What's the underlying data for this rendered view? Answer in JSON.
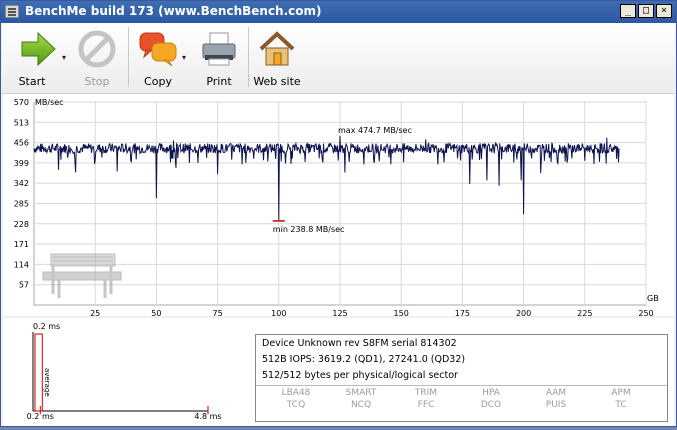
{
  "window": {
    "title": "BenchMe build 173 (www.BenchBench.com)",
    "controls": {
      "minimize": "_",
      "maximize": "□",
      "close": "×"
    }
  },
  "toolbar": {
    "start_label": "Start",
    "stop_label": "Stop",
    "copy_label": "Copy",
    "print_label": "Print",
    "website_label": "Web site",
    "icons": {
      "start": "green-arrow-right",
      "stop": "no-entry",
      "copy": "speech-bubbles",
      "print": "printer",
      "website": "house"
    },
    "dropdown_arrow": "▾"
  },
  "chart_data": [
    {
      "type": "line",
      "title": "",
      "ylabel": "MB/sec",
      "xlabel": "GB",
      "ylim": [
        0,
        570
      ],
      "xlim": [
        0,
        250
      ],
      "yticks": [
        "570",
        "513",
        "456",
        "399",
        "342",
        "285",
        "228",
        "171",
        "114",
        "57"
      ],
      "xticks": [
        "25",
        "50",
        "75",
        "100",
        "125",
        "150",
        "175",
        "200",
        "225",
        "250"
      ],
      "grid": true,
      "annotations": {
        "max": "max 474.7 MB/sec",
        "min": "min 238.8 MB/sec",
        "max_value": 474.7,
        "min_value": 238.8,
        "max_x": 125,
        "min_x": 100
      },
      "series": [
        {
          "baseline": 440,
          "x_end": 239,
          "dips": [
            {
              "x": 10,
              "y": 380
            },
            {
              "x": 17,
              "y": 372
            },
            {
              "x": 34,
              "y": 375
            },
            {
              "x": 50,
              "y": 300
            },
            {
              "x": 58,
              "y": 385
            },
            {
              "x": 67,
              "y": 399
            },
            {
              "x": 75,
              "y": 368
            },
            {
              "x": 85,
              "y": 395
            },
            {
              "x": 100,
              "y": 238.8
            },
            {
              "x": 118,
              "y": 400
            },
            {
              "x": 127,
              "y": 372
            },
            {
              "x": 139,
              "y": 399
            },
            {
              "x": 151,
              "y": 401
            },
            {
              "x": 165,
              "y": 395
            },
            {
              "x": 178,
              "y": 340
            },
            {
              "x": 185,
              "y": 350
            },
            {
              "x": 190,
              "y": 335
            },
            {
              "x": 196,
              "y": 400
            },
            {
              "x": 199,
              "y": 350
            },
            {
              "x": 200,
              "y": 255
            },
            {
              "x": 207,
              "y": 370
            },
            {
              "x": 214,
              "y": 398
            },
            {
              "x": 225,
              "y": 405
            },
            {
              "x": 231,
              "y": 402
            }
          ],
          "peaks": [
            {
              "x": 57,
              "y": 462
            },
            {
              "x": 125,
              "y": 474.7
            },
            {
              "x": 160,
              "y": 465
            },
            {
              "x": 234,
              "y": 470
            }
          ]
        }
      ]
    },
    {
      "type": "bar",
      "title": "",
      "top_label": "0.2 ms",
      "xticks": [
        "0.2 ms",
        "4.8 ms"
      ],
      "bar_label": "average",
      "values": [
        0.2
      ],
      "xlim": [
        0,
        4.8
      ]
    }
  ],
  "device_info": {
    "line1": "Device Unknown rev S8FM serial 814302",
    "line2": "512B IOPS: 3619.2 (QD1), 27241.0 (QD32)",
    "line3": "512/512 bytes per physical/logical sector"
  },
  "features": [
    {
      "a": "LBA48",
      "b": "TCQ"
    },
    {
      "a": "SMART",
      "b": "NCQ"
    },
    {
      "a": "TRIM",
      "b": "FFC"
    },
    {
      "a": "HPA",
      "b": "DCO"
    },
    {
      "a": "AAM",
      "b": "PUIS"
    },
    {
      "a": "APM",
      "b": "TC"
    }
  ],
  "colors": {
    "titlebar": "#2c58a2",
    "plot_line": "#0d1450",
    "annotation_red": "#cc0000",
    "grid": "#d8d8d8",
    "feature_disabled": "#9c9c9c"
  }
}
